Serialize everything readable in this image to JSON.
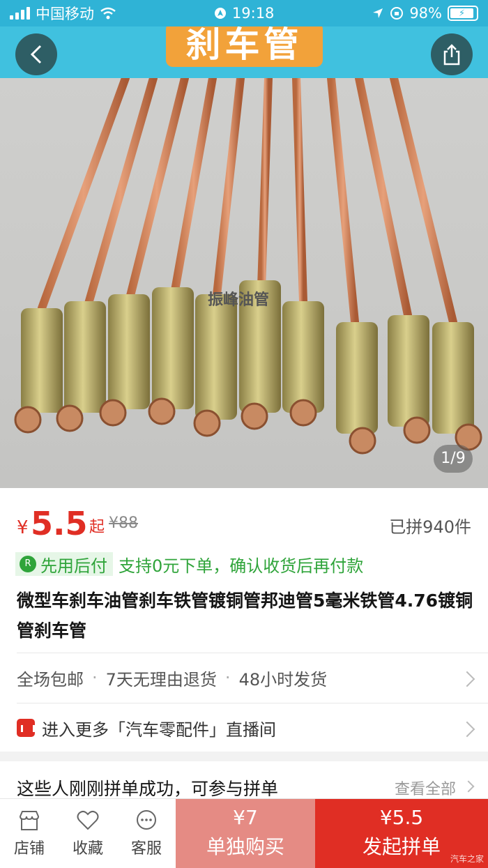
{
  "status_bar": {
    "carrier": "中国移动",
    "time": "19:18",
    "battery": "98%"
  },
  "hero": {
    "banner_text": "刹车管",
    "watermark": "振峰油管",
    "counter": "1/9"
  },
  "product": {
    "currency": "¥",
    "price": "5.5",
    "price_suffix": "起",
    "original_price": "¥88",
    "sold_text": "已拼940件",
    "pay_later_label": "先用后付",
    "pay_later_desc": "支持0元下单，确认收货后再付款",
    "title": "微型车刹车油管刹车铁管镀铜管邦迪管5毫米铁管4.76镀铜管刹车管"
  },
  "features": [
    "全场包邮",
    "7天无理由退货",
    "48小时发货"
  ],
  "live_link": "进入更多「汽车零配件」直播间",
  "group": {
    "title": "这些人刚刚拼单成功，可参与拼单",
    "view_all": "查看全部"
  },
  "bottom_bar": {
    "nav": [
      {
        "label": "店铺",
        "icon": "store-icon"
      },
      {
        "label": "收藏",
        "icon": "heart-icon"
      },
      {
        "label": "客服",
        "icon": "chat-icon"
      }
    ],
    "solo_price": "¥7",
    "solo_label": "单独购买",
    "group_price": "¥5.5",
    "group_label": "发起拼单"
  },
  "corner_watermark": "汽车之家",
  "colors": {
    "accent_red": "#e02e24",
    "pay_green": "#2fa43a",
    "header_cyan": "#2fb3d6"
  }
}
